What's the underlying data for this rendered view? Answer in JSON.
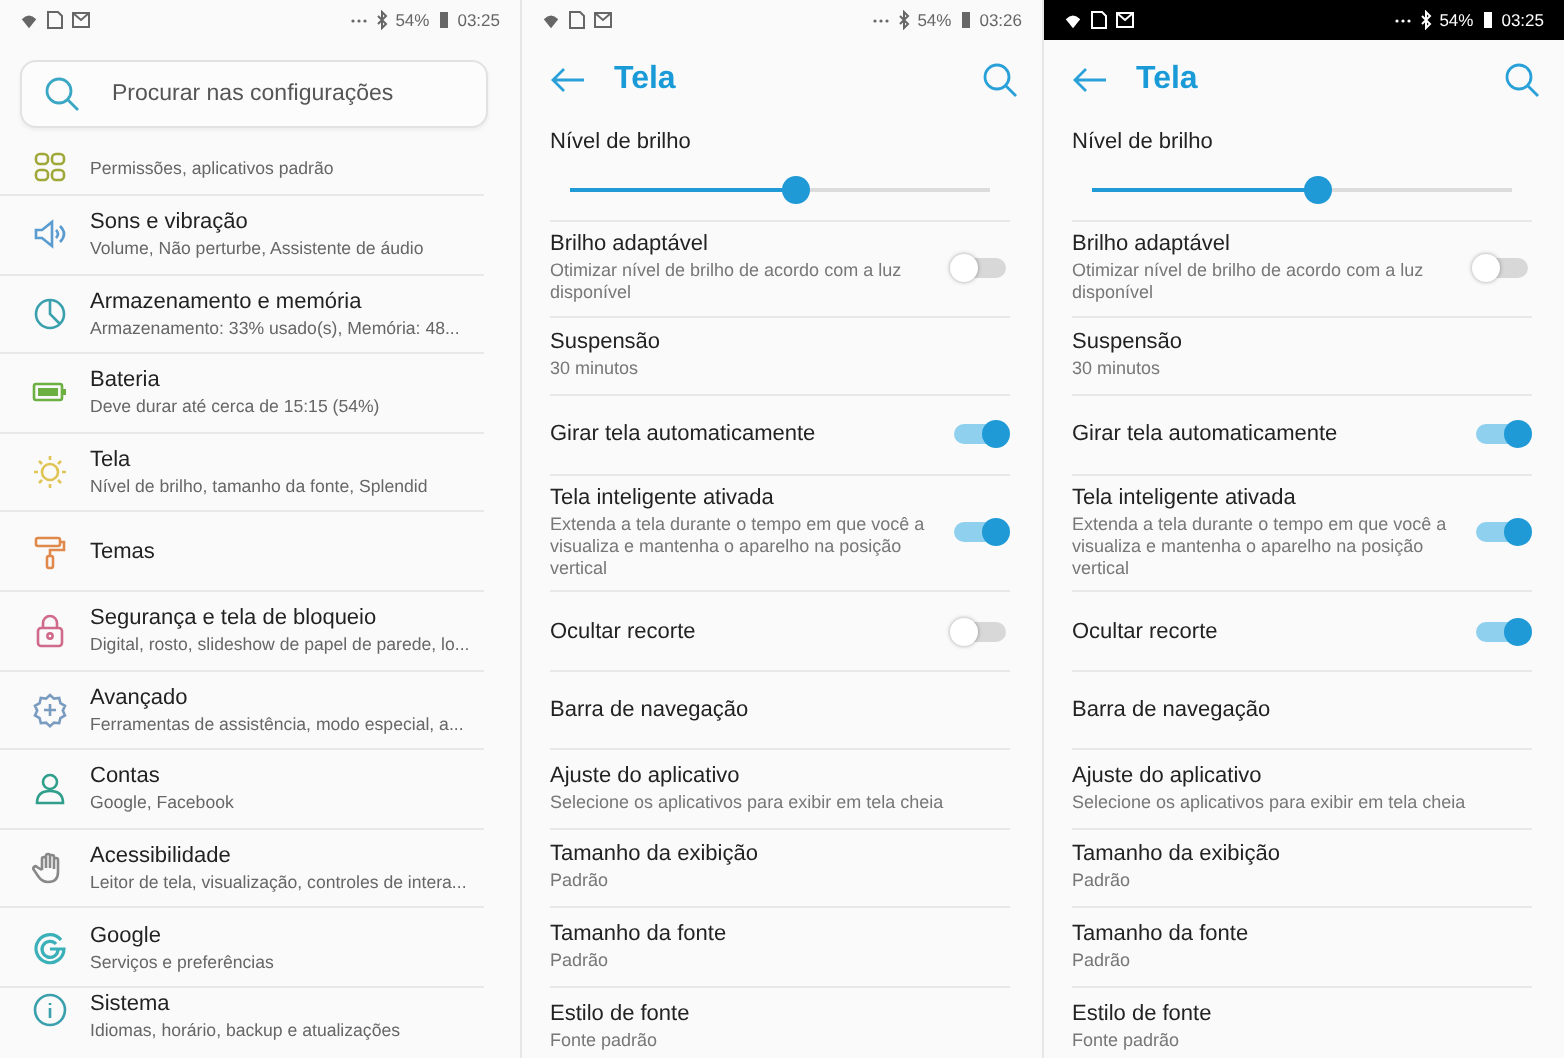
{
  "panels": [
    {
      "kind": "settings_list",
      "status_bar": {
        "battery": "54%",
        "time": "03:25",
        "dark": false
      },
      "search": {
        "placeholder": "Procurar nas configurações"
      },
      "items": [
        {
          "subtitle": "Permissões, aplicativos padrão"
        },
        {
          "title": "Sons e vibração",
          "subtitle": "Volume, Não perturbe, Assistente de áudio"
        },
        {
          "title": "Armazenamento e memória",
          "subtitle": "Armazenamento: 33% usado(s), Memória: 48..."
        },
        {
          "title": "Bateria",
          "subtitle": "Deve durar até cerca de 15:15 (54%)"
        },
        {
          "title": "Tela",
          "subtitle": "Nível de brilho, tamanho da fonte, Splendid"
        },
        {
          "title": "Temas"
        },
        {
          "title": "Segurança e tela de bloqueio",
          "subtitle": "Digital, rosto, slideshow de papel de parede, lo..."
        },
        {
          "title": "Avançado",
          "subtitle": "Ferramentas de assistência, modo especial, a..."
        },
        {
          "title": "Contas",
          "subtitle": "Google, Facebook"
        },
        {
          "title": "Acessibilidade",
          "subtitle": "Leitor de tela, visualização, controles de intera..."
        },
        {
          "title": "Google",
          "subtitle": "Serviços e preferências"
        },
        {
          "title": "Sistema",
          "subtitle": "Idiomas, horário, backup e atualizações"
        }
      ]
    },
    {
      "kind": "display_settings",
      "status_bar": {
        "battery": "54%",
        "time": "03:26",
        "dark": false
      },
      "title": "Tela",
      "rows": [
        {
          "kind": "slider",
          "title": "Nível de brilho",
          "level": 0.54
        },
        {
          "kind": "toggle",
          "title": "Brilho adaptável",
          "subtitle": "Otimizar nível de brilho de acordo com a luz disponível",
          "on": false
        },
        {
          "kind": "text",
          "title": "Suspensão",
          "subtitle": "30 minutos"
        },
        {
          "kind": "toggle",
          "title": "Girar tela automaticamente",
          "on": true
        },
        {
          "kind": "toggle",
          "title": "Tela inteligente ativada",
          "subtitle": "Extenda a tela durante o tempo em que você a visualiza e mantenha o aparelho na posição vertical",
          "on": true
        },
        {
          "kind": "toggle",
          "title": "Ocultar recorte",
          "on": false
        },
        {
          "kind": "text",
          "title": "Barra de navegação"
        },
        {
          "kind": "text",
          "title": "Ajuste do aplicativo",
          "subtitle": "Selecione os aplicativos para exibir em tela cheia"
        },
        {
          "kind": "text",
          "title": "Tamanho da exibição",
          "subtitle": "Padrão"
        },
        {
          "kind": "text",
          "title": "Tamanho da fonte",
          "subtitle": "Padrão"
        },
        {
          "kind": "text",
          "title": "Estilo de fonte",
          "subtitle": "Fonte padrão"
        }
      ]
    },
    {
      "kind": "display_settings",
      "status_bar": {
        "battery": "54%",
        "time": "03:25",
        "dark": true
      },
      "title": "Tela",
      "rows": [
        {
          "kind": "slider",
          "title": "Nível de brilho",
          "level": 0.54
        },
        {
          "kind": "toggle",
          "title": "Brilho adaptável",
          "subtitle": "Otimizar nível de brilho de acordo com a luz disponível",
          "on": false
        },
        {
          "kind": "text",
          "title": "Suspensão",
          "subtitle": "30 minutos"
        },
        {
          "kind": "toggle",
          "title": "Girar tela automaticamente",
          "on": true
        },
        {
          "kind": "toggle",
          "title": "Tela inteligente ativada",
          "subtitle": "Extenda a tela durante o tempo em que você a visualiza e mantenha o aparelho na posição vertical",
          "on": true
        },
        {
          "kind": "toggle",
          "title": "Ocultar recorte",
          "on": true
        },
        {
          "kind": "text",
          "title": "Barra de navegação"
        },
        {
          "kind": "text",
          "title": "Ajuste do aplicativo",
          "subtitle": "Selecione os aplicativos para exibir em tela cheia"
        },
        {
          "kind": "text",
          "title": "Tamanho da exibição",
          "subtitle": "Padrão"
        },
        {
          "kind": "text",
          "title": "Tamanho da fonte",
          "subtitle": "Padrão"
        },
        {
          "kind": "text",
          "title": "Estilo de fonte",
          "subtitle": "Fonte padrão"
        }
      ]
    }
  ]
}
